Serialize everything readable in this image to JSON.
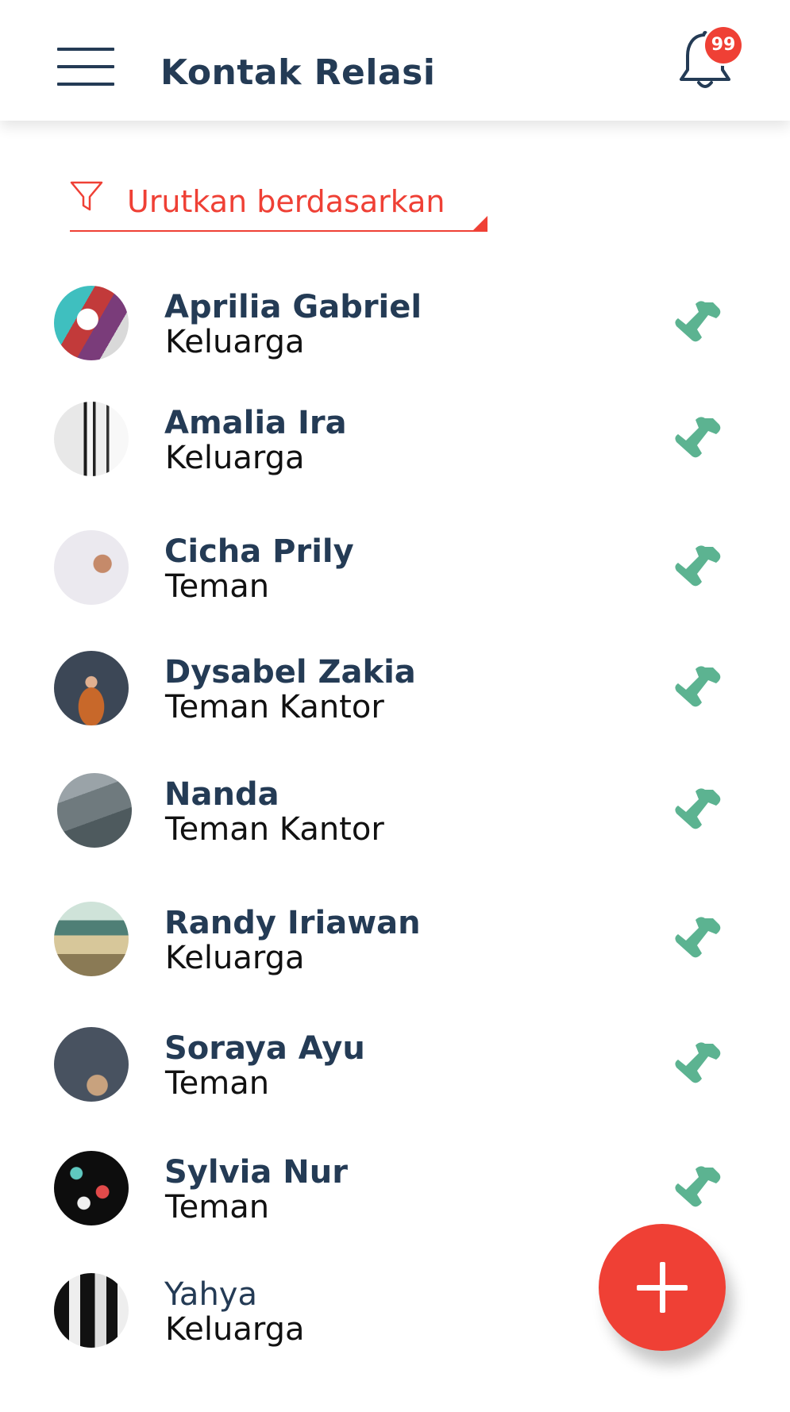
{
  "header": {
    "title": "Kontak Relasi",
    "notification_count": "99"
  },
  "sort": {
    "label": "Urutkan berdasarkan"
  },
  "contacts": [
    {
      "name": "Aprilia Gabriel",
      "group": "Keluarga"
    },
    {
      "name": "Amalia Ira",
      "group": "Keluarga"
    },
    {
      "name": "Cicha Prily",
      "group": "Teman"
    },
    {
      "name": "Dysabel Zakia",
      "group": "Teman Kantor"
    },
    {
      "name": "Nanda",
      "group": "Teman Kantor"
    },
    {
      "name": "Randy Iriawan",
      "group": "Keluarga"
    },
    {
      "name": "Soraya Ayu",
      "group": "Teman"
    },
    {
      "name": "Sylvia Nur",
      "group": "Teman"
    },
    {
      "name": "Yahya",
      "group": "Keluarga"
    }
  ],
  "colors": {
    "primary_text": "#243b55",
    "accent": "#ef4035",
    "call_icon": "#5cb391"
  },
  "icons": {
    "menu": "hamburger-menu-icon",
    "notification": "bell-icon",
    "filter": "funnel-icon",
    "call": "phone-icon",
    "add": "plus-icon"
  }
}
